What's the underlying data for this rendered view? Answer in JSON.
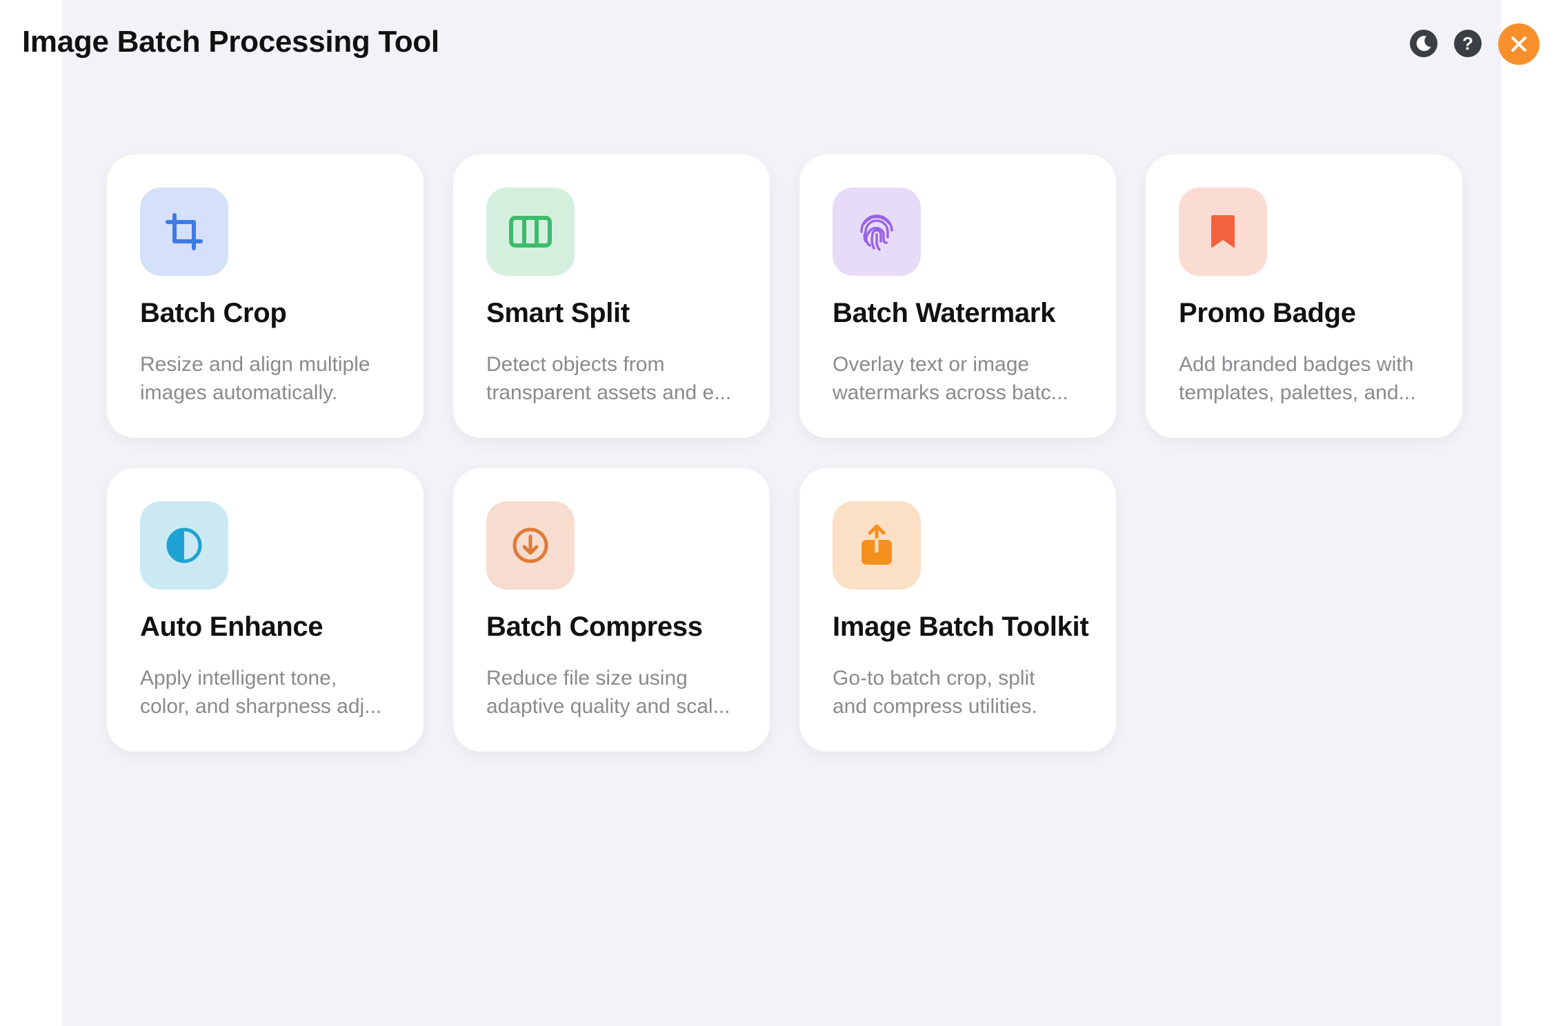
{
  "app": {
    "title": "Image Batch Processing Tool"
  },
  "toolbar": {
    "theme_icon": "moon-icon",
    "help_label": "?",
    "close_icon": "close-icon"
  },
  "colors": {
    "background": "#f2f2f7",
    "close_button": "#f7902b",
    "icon_button": "#3a3f44"
  },
  "tools": [
    {
      "title": "Batch Crop",
      "desc_line1": "Resize and align multiple",
      "desc_line2": "images automatically.",
      "icon": "crop-icon",
      "tile_color": "#d5e0fa",
      "icon_color": "#3f7be6"
    },
    {
      "title": "Smart Split",
      "desc_line1": "Detect objects from",
      "desc_line2": "transparent assets and e...",
      "icon": "split-columns-icon",
      "tile_color": "#d5efdf",
      "icon_color": "#3dbb6a"
    },
    {
      "title": "Batch Watermark",
      "desc_line1": "Overlay text or image",
      "desc_line2": "watermarks across batc...",
      "icon": "fingerprint-icon",
      "tile_color": "#e6dcf8",
      "icon_color": "#9a62e6"
    },
    {
      "title": "Promo Badge",
      "desc_line1": "Add branded badges with",
      "desc_line2": "templates, palettes, and...",
      "icon": "bookmark-icon",
      "tile_color": "#fbdcd2",
      "icon_color": "#f2623e"
    },
    {
      "title": "Auto Enhance",
      "desc_line1": "Apply intelligent tone,",
      "desc_line2": "color, and sharpness adj...",
      "icon": "half-circle-icon",
      "tile_color": "#cbe9f3",
      "icon_color": "#1fa3d4"
    },
    {
      "title": "Batch Compress",
      "desc_line1": "Reduce file size using",
      "desc_line2": "adaptive quality and scal...",
      "icon": "download-circle-icon",
      "tile_color": "#f6ddcf",
      "icon_color": "#e07a35"
    },
    {
      "title": "Image Batch Toolkit",
      "desc_line1": "Go-to batch crop, split",
      "desc_line2": "and compress utilities.",
      "icon": "share-box-icon",
      "tile_color": "#fbe0c5",
      "icon_color": "#f5901f"
    }
  ]
}
